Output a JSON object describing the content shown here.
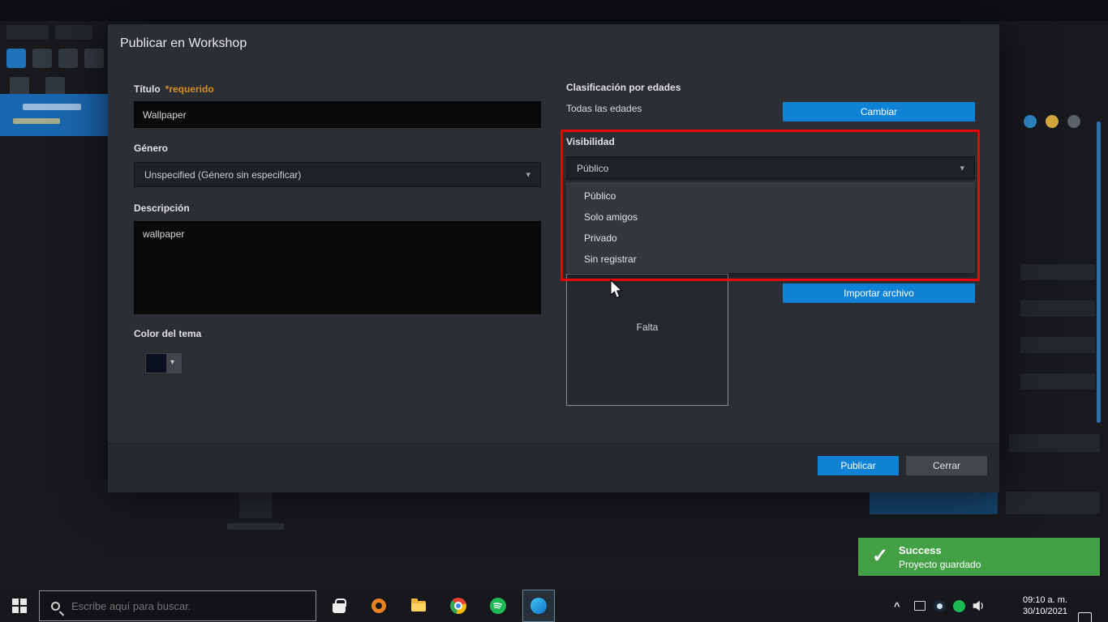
{
  "dialog": {
    "title": "Publicar en Workshop",
    "title_field": {
      "label": "Título",
      "required": "*requerido",
      "value": "Wallpaper"
    },
    "genre_field": {
      "label": "Género",
      "value": "Unspecified (Género sin especificar)"
    },
    "description_field": {
      "label": "Descripción",
      "value": "wallpaper"
    },
    "theme_color_field": {
      "label": "Color del tema"
    },
    "age_rating": {
      "label": "Clasificación por edades",
      "value": "Todas las edades",
      "change_button": "Cambiar"
    },
    "visibility": {
      "label": "Visibilidad",
      "value": "Público",
      "options": [
        "Público",
        "Solo amigos",
        "Privado",
        "Sin registrar"
      ]
    },
    "preview": {
      "missing_text": "Falta",
      "import_button": "Importar archivo"
    },
    "footer": {
      "publish_button": "Publicar",
      "close_button": "Cerrar"
    }
  },
  "toast": {
    "title": "Success",
    "message": "Proyecto guardado"
  },
  "taskbar": {
    "search_placeholder": "Escribe aquí para buscar.",
    "clock": {
      "time": "09:10 a. m.",
      "date": "30/10/2021"
    }
  },
  "icons": {
    "chevron_down_glyph": "▾",
    "chevron_up_glyph": "^",
    "check_glyph": "✓"
  },
  "colors": {
    "accent_blue": "#0f82d6",
    "annotation_red": "#ee0000",
    "success_green": "#43a047",
    "required_orange": "#d78d24"
  }
}
